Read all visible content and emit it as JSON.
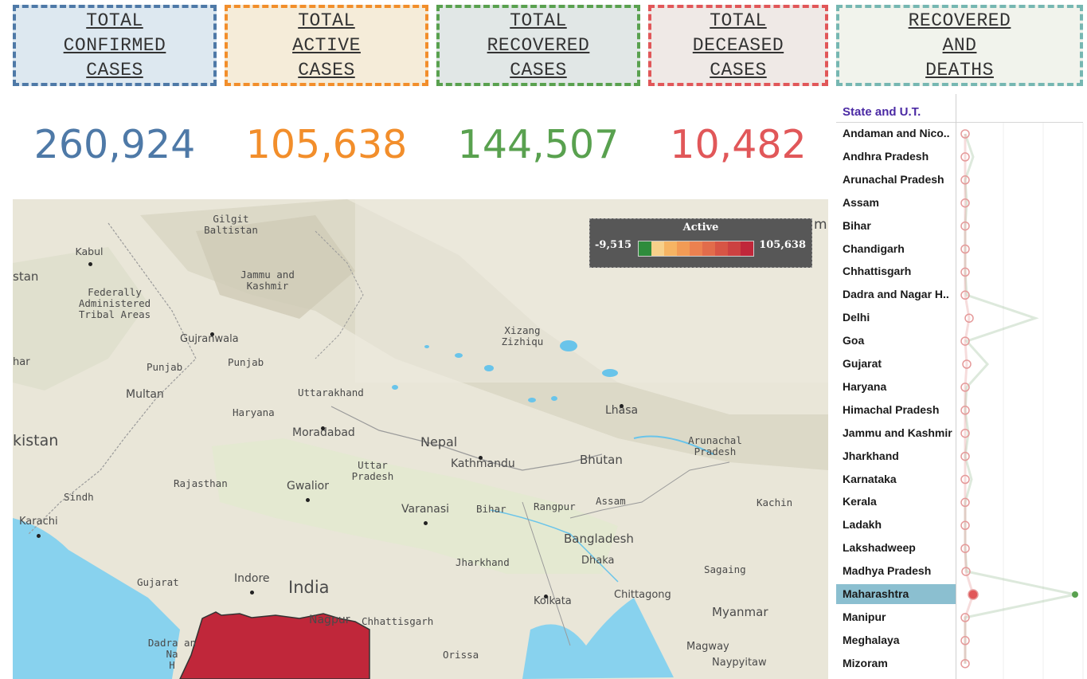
{
  "kpi": {
    "confirmed": {
      "label": "TOTAL\nCONFIRMED\nCASES",
      "value": "260,924",
      "color": "#4e79a7"
    },
    "active": {
      "label": "TOTAL\nACTIVE\nCASES",
      "value": "105,638",
      "color": "#f28e2b"
    },
    "recovered": {
      "label": "TOTAL\nRECOVERED\nCASES",
      "value": "144,507",
      "color": "#59a14f"
    },
    "deceased": {
      "label": "TOTAL\nDECEASED\nCASES",
      "value": "10,482",
      "color": "#e15759"
    },
    "rec_deaths": {
      "label": "RECOVERED\nAND\nDEATHS",
      "color": "#76b7b2"
    }
  },
  "map": {
    "labels": {
      "gilgit": "Gilgit\nBaltistan",
      "kabul": "Kabul",
      "stan": "stan",
      "federally": "Federally\nAdministered\nTribal Areas",
      "jammu": "Jammu and\nKashmir",
      "gujranwala": "Gujranwala",
      "har": "har",
      "punjab_pk": "Punjab",
      "punjab_in": "Punjab",
      "multan": "Multan",
      "pakistan": "kistan",
      "uttarakhand": "Uttarakhand",
      "haryana": "Haryana",
      "xizang": "Xizang\nZizhiqu",
      "lhasa": "Lhasa",
      "moradabad": "Moradabad",
      "nepal": "Nepal",
      "kathmandu": "Kathmandu",
      "bhutan": "Bhutan",
      "arunachal": "Arunachal\nPradesh",
      "rajasthan": "Rajasthan",
      "gwalior": "Gwalior",
      "uttar": "Uttar\nPradesh",
      "sindh": "Sindh",
      "karachi": "Karachi",
      "varanasi": "Varanasi",
      "bihar": "Bihar",
      "rangpur": "Rangpur",
      "assam": "Assam",
      "kachin": "Kachin",
      "bangladesh": "Bangladesh",
      "jharkhand": "Jharkhand",
      "dhaka": "Dhaka",
      "gujarat": "Gujarat",
      "indore": "Indore",
      "india": "India",
      "sagaing": "Sagaing",
      "nagpur": "Nagpur",
      "chhattisgarh": "Chhattisgarh",
      "kolkata": "Kolkata",
      "chittagong": "Chittagong",
      "myanmar": "Myanmar",
      "dadra": "Dadra an\nNa\nH",
      "orissa": "Orissa",
      "magway": "Magway",
      "naypyitaw": "Naypyitaw",
      "rightcut": "mi"
    },
    "legend": {
      "title": "Active",
      "min": "-9,515",
      "max": "105,638",
      "highlight_color": "#c0273a"
    }
  },
  "states_panel": {
    "header": "State and U.T.",
    "selected": "Maharashtra",
    "states": [
      "Andaman and Nico..",
      "Andhra Pradesh",
      "Arunachal Pradesh",
      "Assam",
      "Bihar",
      "Chandigarh",
      "Chhattisgarh",
      "Dadra and Nagar H..",
      "Delhi",
      "Goa",
      "Gujarat",
      "Haryana",
      "Himachal Pradesh",
      "Jammu and Kashmir",
      "Jharkhand",
      "Karnataka",
      "Kerala",
      "Ladakh",
      "Lakshadweep",
      "Madhya Pradesh",
      "Maharashtra",
      "Manipur",
      "Meghalaya",
      "Mizoram"
    ]
  }
}
